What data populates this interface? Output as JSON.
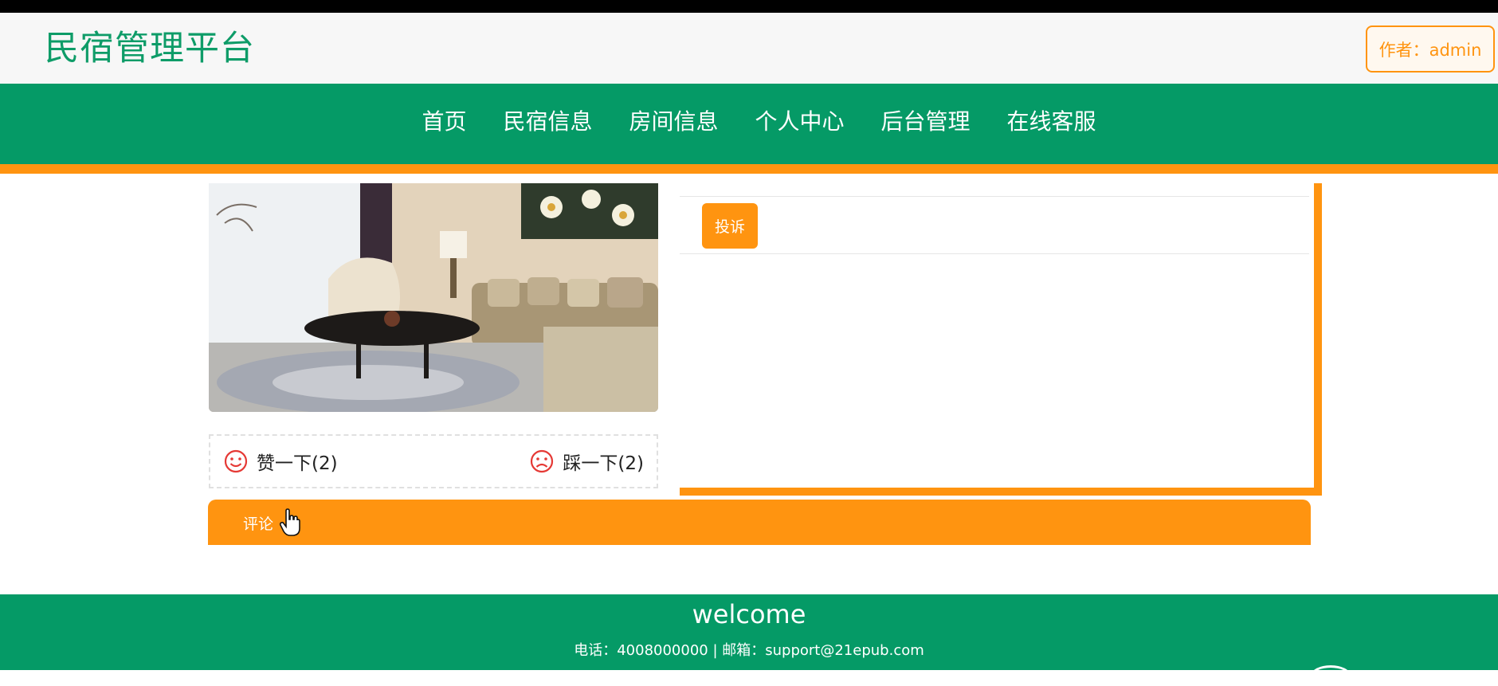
{
  "header": {
    "title": "民宿管理平台",
    "author_label": "作者：admin"
  },
  "nav": {
    "items": [
      "首页",
      "民宿信息",
      "房间信息",
      "个人中心",
      "后台管理",
      "在线客服"
    ]
  },
  "content": {
    "image_alt": "living room",
    "like_label": "赞一下(2)",
    "dislike_label": "踩一下(2)",
    "complain_label": "投诉",
    "comment_tab_label": "评论"
  },
  "footer": {
    "welcome": "welcome",
    "contact": "电话：4008000000 | 邮箱：support@21epub.com"
  },
  "colors": {
    "brand_green": "#059a66",
    "accent_orange": "#ff9410"
  },
  "icons": {
    "like": "smile-icon",
    "dislike": "frown-icon",
    "cursor": "hand-pointer-icon"
  }
}
